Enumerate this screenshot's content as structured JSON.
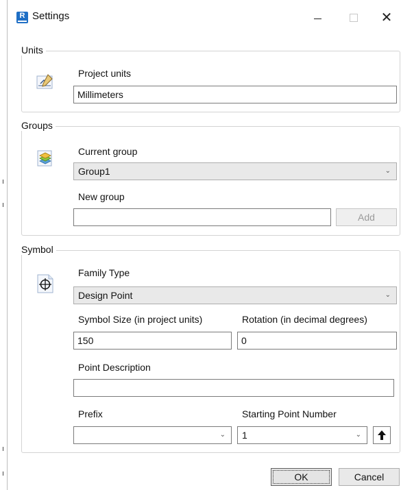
{
  "window": {
    "title": "Settings",
    "app_icon_letter": "R",
    "minimize_glyph": "minimize-icon",
    "maximize_glyph": "maximize-icon",
    "close_glyph": "✕"
  },
  "units": {
    "legend": "Units",
    "icon": "pencil-ruler-icon",
    "project_units_label": "Project units",
    "project_units_value": "Millimeters"
  },
  "groups": {
    "legend": "Groups",
    "icon": "layers-icon",
    "current_group_label": "Current group",
    "current_group_value": "Group1",
    "new_group_label": "New group",
    "new_group_value": "",
    "add_label": "Add"
  },
  "symbol": {
    "legend": "Symbol",
    "icon": "crosshair-icon",
    "family_type_label": "Family Type",
    "family_type_value": "Design Point",
    "symbol_size_label": "Symbol Size (in project units)",
    "symbol_size_value": "150",
    "rotation_label": "Rotation (in decimal degrees)",
    "rotation_value": "0",
    "point_description_label": "Point Description",
    "point_description_value": "",
    "prefix_label": "Prefix",
    "prefix_value": "",
    "starting_point_number_label": "Starting Point Number",
    "starting_point_number_value": "1"
  },
  "footer": {
    "ok_label": "OK",
    "cancel_label": "Cancel"
  },
  "colors": {
    "app_icon": "#1f6fc5",
    "group_border": "#d3d3d3",
    "combo_bg": "#e9e9e9"
  }
}
